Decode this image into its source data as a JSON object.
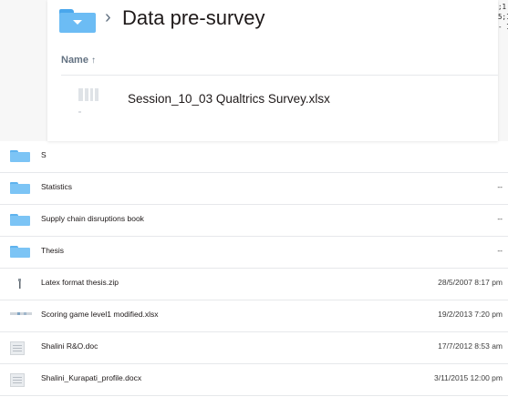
{
  "preview": {
    "title": "Data pre-survey",
    "breadcrumb_separator": "›",
    "column_header": "Name",
    "sort_indicator": "↑",
    "file": {
      "name": "Session_10_03 Qualtrics Survey.xlsx",
      "icon": "spreadsheet-thumbnail-icon"
    }
  },
  "file_list": {
    "rows": [
      {
        "name": "S",
        "date": "",
        "icon": "folder-icon"
      },
      {
        "name": "Statistics",
        "date": "--",
        "icon": "folder-icon"
      },
      {
        "name": "Supply chain disruptions book",
        "date": "--",
        "icon": "folder-icon"
      },
      {
        "name": "Thesis",
        "date": "--",
        "icon": "folder-icon"
      },
      {
        "name": "Latex format thesis.zip",
        "date": "28/5/2007 8:17 pm",
        "icon": "zip-file-icon"
      },
      {
        "name": "Scoring game level1 modified.xlsx",
        "date": "19/2/2013 7:20 pm",
        "icon": "spreadsheet-thumbnail-icon"
      },
      {
        "name": "Shalini R&O.doc",
        "date": "17/7/2012 8:53 am",
        "icon": "document-thumbnail-icon"
      },
      {
        "name": "Shalini_Kurapati_profile.docx",
        "date": "3/11/2015 12:00 pm",
        "icon": "document-thumbnail-icon"
      }
    ]
  },
  "code_fragment": [
    ";1",
    "5;1",
    "- 1"
  ],
  "colors": {
    "folder": "#7cc4f5",
    "folder_dark": "#4aa7ec",
    "text": "#1e1919",
    "muted": "#637282"
  }
}
